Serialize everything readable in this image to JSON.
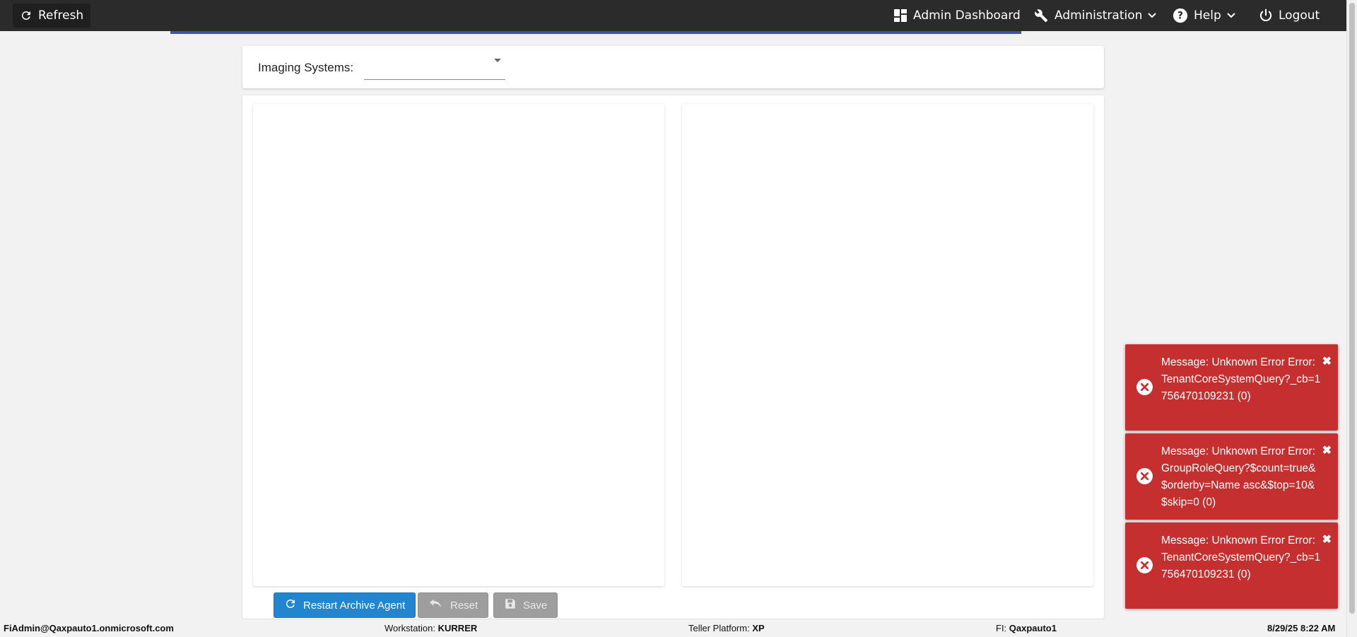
{
  "nav": {
    "refresh_label": "Refresh",
    "admin_dashboard_label": "Admin Dashboard",
    "administration_label": "Administration",
    "help_label": "Help",
    "logout_label": "Logout"
  },
  "filter": {
    "label": "Imaging Systems:",
    "selected": ""
  },
  "actions": {
    "restart_label": "Restart Archive Agent",
    "reset_label": "Reset",
    "save_label": "Save"
  },
  "status": {
    "user": "FiAdmin@Qaxpauto1.onmicrosoft.com",
    "workstation_label": "Workstation:",
    "workstation_value": "KURRER",
    "teller_label": "Teller Platform:",
    "teller_value": "XP",
    "fi_label": "FI:",
    "fi_value": "Qaxpauto1",
    "datetime": "8/29/25 8:22 AM"
  },
  "toasts": [
    {
      "message": "Message: Unknown Error Error: TenantCoreSystemQuery?_cb=1756470109231 (0)"
    },
    {
      "message": "Message: Unknown Error Error: GroupRoleQuery?$count=true&$orderby=Name asc&$top=10&$skip=0 (0)"
    },
    {
      "message": "Message: Unknown Error Error: TenantCoreSystemQuery?_cb=1756470109231 (0)"
    }
  ],
  "colors": {
    "topbar": "#2b2b2b",
    "accent": "#3f51b5",
    "primary_button": "#2185d0",
    "error_toast": "#c62f2f"
  },
  "icons": [
    "refresh-icon",
    "dashboard-icon",
    "wrench-icon",
    "chevron-down-icon",
    "help-icon",
    "power-icon",
    "undo-icon",
    "save-icon",
    "error-icon",
    "close-icon"
  ]
}
